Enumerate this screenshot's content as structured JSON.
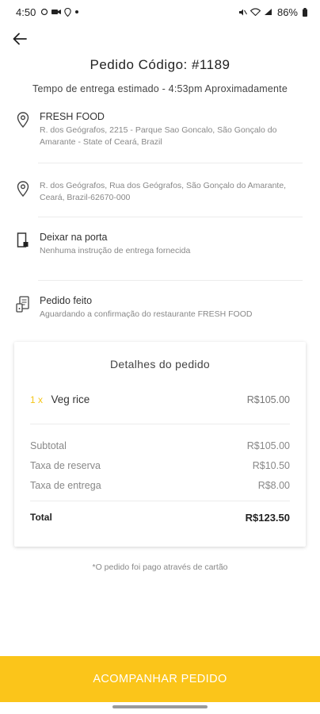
{
  "status_bar": {
    "time": "4:50",
    "battery": "86%"
  },
  "header": {
    "title": "Pedido Código: #1189",
    "eta": "Tempo de entrega estimado - 4:53pm Aproximadamente"
  },
  "pickup": {
    "name": "FRESH FOOD",
    "address": "R. dos Geógrafos, 2215 - Parque Sao Goncalo, São Gonçalo do Amarante - State of Ceará, Brazil"
  },
  "dropoff": {
    "address": "R. dos Geógrafos, Rua dos Geógrafos, São Gonçalo do Amarante, Ceará, Brazil-62670-000"
  },
  "delivery_instruction": {
    "title": "Deixar na porta",
    "note": "Nenhuma instrução de entrega fornecida"
  },
  "order_status": {
    "title": "Pedido feito",
    "note": "Aguardando a confirmação do restaurante FRESH FOOD"
  },
  "order_details": {
    "title": "Detalhes do pedido",
    "items": [
      {
        "qty": "1 x",
        "name": "Veg rice",
        "price": "R$105.00"
      }
    ],
    "subtotal_label": "Subtotal",
    "subtotal_value": "R$105.00",
    "booking_fee_label": "Taxa de reserva",
    "booking_fee_value": "R$10.50",
    "delivery_fee_label": "Taxa de entrega",
    "delivery_fee_value": "R$8.00",
    "total_label": "Total",
    "total_value": "R$123.50"
  },
  "payment_note": "*O pedido foi pago através de cartão",
  "track_button": "ACOMPANHAR PEDIDO",
  "colors": {
    "accent": "#fbc51a",
    "qty": "#f5c518"
  }
}
